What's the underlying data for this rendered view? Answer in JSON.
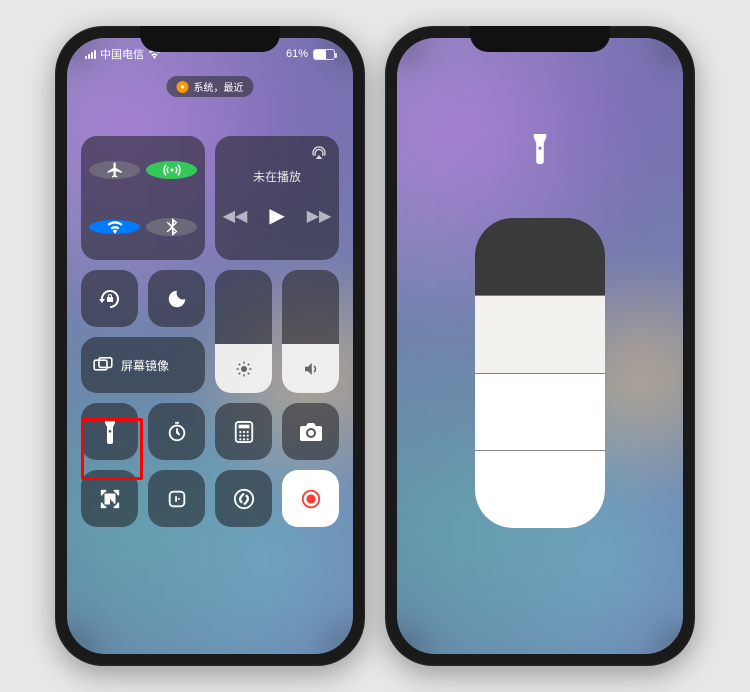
{
  "status": {
    "carrier": "中国电信",
    "battery_text": "61%",
    "battery_level": 61
  },
  "pill": {
    "text": "系统，最近"
  },
  "media": {
    "title": "未在播放"
  },
  "screen_mirror": {
    "label": "屏幕镜像"
  },
  "sliders": {
    "brightness_pct": 40,
    "volume_pct": 40
  },
  "flashlight_detail": {
    "level": 3,
    "max": 4
  }
}
